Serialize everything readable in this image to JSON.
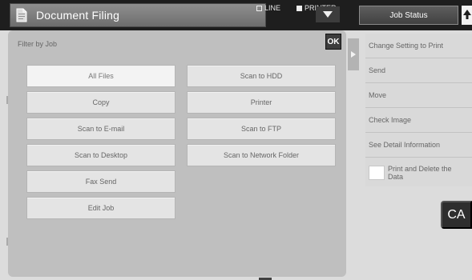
{
  "app": {
    "title": "Document Filing",
    "mode_line": "LINE",
    "mode_printer": "PRINTER",
    "job_status": "Job Status",
    "icons": {
      "document": "document-filing-icon",
      "arrow": "chevron-down-icon",
      "corner": "up-arrow-icon",
      "side_tab": "chevron-right-icon"
    }
  },
  "filter": {
    "label": "Filter by Job",
    "ok_label": "OK",
    "options": [
      {
        "label": "All Files",
        "state": "selected"
      },
      {
        "label": "Scan to HDD",
        "state": "normal"
      },
      {
        "label": "Copy",
        "state": "normal"
      },
      {
        "label": "Printer",
        "state": "normal"
      },
      {
        "label": "Scan to E-mail",
        "state": "normal"
      },
      {
        "label": "Scan to FTP",
        "state": "normal"
      },
      {
        "label": "Scan to Desktop",
        "state": "normal"
      },
      {
        "label": "Scan to Network Folder",
        "state": "normal"
      },
      {
        "label": "Fax Send",
        "state": "normal"
      },
      {
        "label": "Edit Job",
        "state": "normal"
      }
    ]
  },
  "actions": {
    "items": [
      {
        "label": "Change Setting to Print"
      },
      {
        "label": "Send"
      },
      {
        "label": "Move"
      },
      {
        "label": "Check Image"
      },
      {
        "label": "See Detail Information"
      }
    ],
    "print_and_delete": "Print and Delete the Data"
  },
  "clear_all": "CA",
  "colors": {
    "topbar": "#1e1e1e",
    "panel": "#bfbfbf",
    "button": "#e4e4e4",
    "selected_button": "#f3f3f3",
    "menu": "#d9d9d9",
    "ca": "#2e2e2e"
  }
}
